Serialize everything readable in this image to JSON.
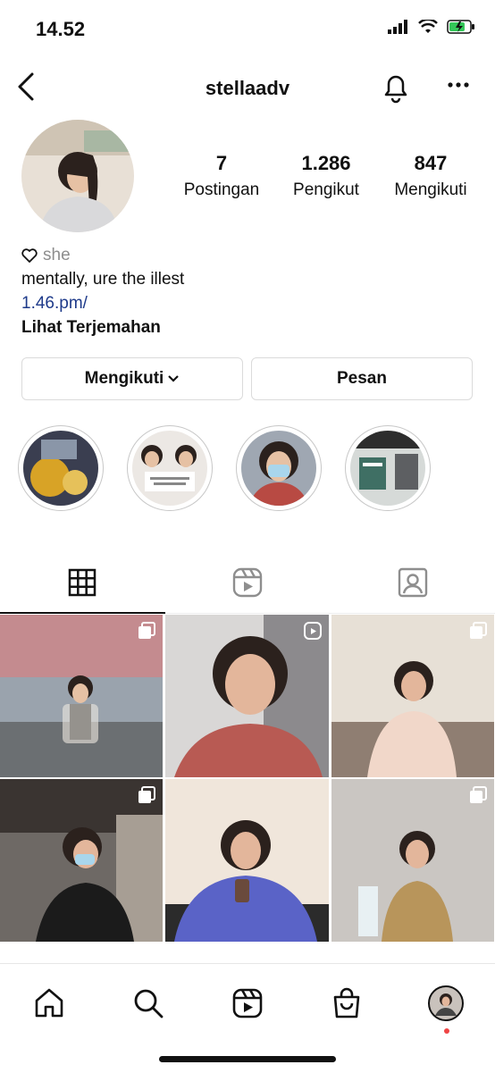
{
  "status": {
    "time": "14.52"
  },
  "header": {
    "username": "stellaadv"
  },
  "stats": [
    {
      "value": "7",
      "label": "Postingan"
    },
    {
      "value": "1.286",
      "label": "Pengikut"
    },
    {
      "value": "847",
      "label": "Mengikuti"
    }
  ],
  "bio": {
    "pronoun": "she",
    "text": "mentally, ure the illest",
    "link": "1.46.pm/",
    "translate": "Lihat Terjemahan"
  },
  "buttons": {
    "following": "Mengikuti",
    "message": "Pesan"
  },
  "colors": {
    "link": "#1e3a8a",
    "accent_dot": "#ef4444"
  },
  "icons": {
    "tabs": [
      "grid-icon",
      "reels-icon",
      "tagged-icon"
    ],
    "nav": [
      "home-icon",
      "search-icon",
      "reels-icon",
      "shop-icon",
      "profile-avatar"
    ]
  }
}
